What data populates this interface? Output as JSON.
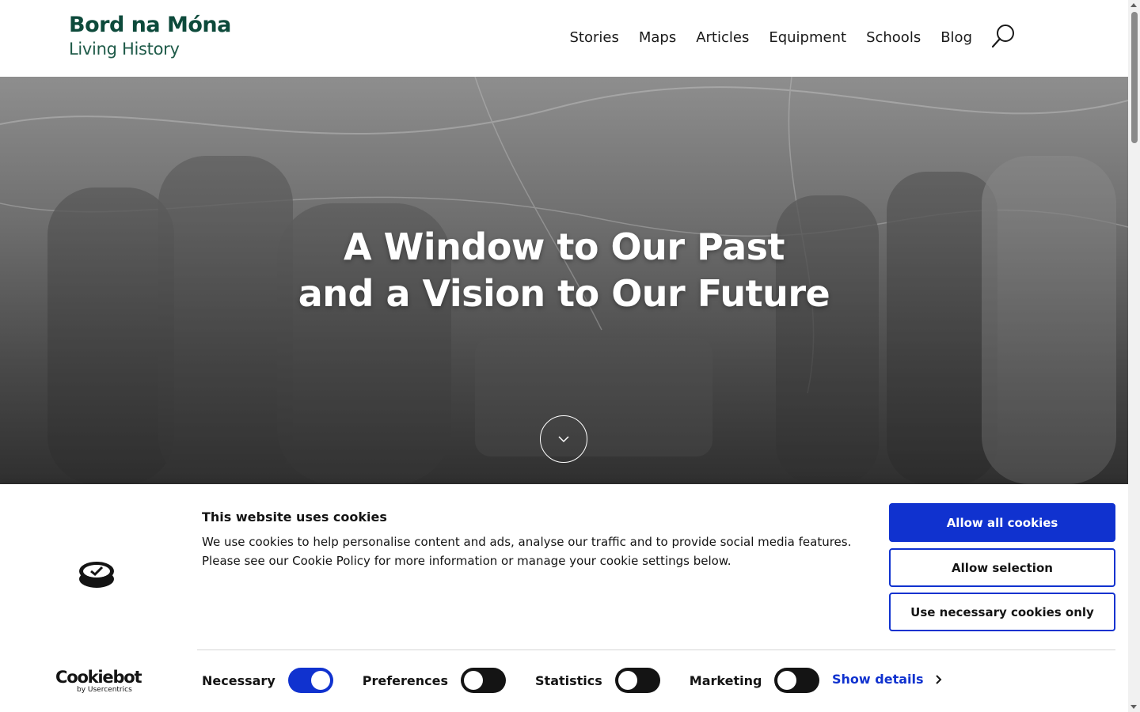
{
  "header": {
    "logo_line1": "Bord na Móna",
    "logo_line2": "Living History",
    "nav": [
      "Stories",
      "Maps",
      "Articles",
      "Equipment",
      "Schools",
      "Blog"
    ]
  },
  "hero": {
    "title_line1": "A Window to Our Past",
    "title_line2": "and a Vision to Our Future"
  },
  "cookie_banner": {
    "brand_name": "Cookiebot",
    "brand_sub": "by Usercentrics",
    "title": "This website uses cookies",
    "text": "We use cookies to help personalise content and ads, analyse our traffic and to provide social media features. Please see our Cookie Policy for more information or manage your cookie settings below.",
    "buttons": {
      "allow_all": "Allow all cookies",
      "allow_selection": "Allow selection",
      "necessary_only": "Use necessary cookies only"
    },
    "toggles": [
      {
        "label": "Necessary",
        "on": true
      },
      {
        "label": "Preferences",
        "on": false
      },
      {
        "label": "Statistics",
        "on": false
      },
      {
        "label": "Marketing",
        "on": false
      }
    ],
    "show_details": "Show details"
  },
  "colors": {
    "brand_green": "#0d4a3b",
    "accent_blue": "#1032cf"
  }
}
